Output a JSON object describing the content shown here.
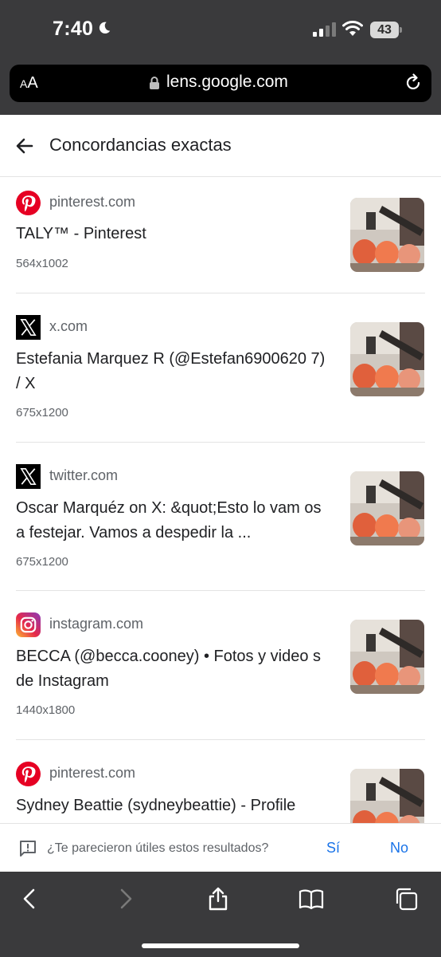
{
  "status_bar": {
    "time": "7:40",
    "battery": "43"
  },
  "browser": {
    "text_size_label_small": "A",
    "text_size_label_large": "A",
    "url": "lens.google.com"
  },
  "header": {
    "title": "Concordancias exactas"
  },
  "results": [
    {
      "site": "pinterest.com",
      "logo": "pinterest-icon",
      "title": "TALY™ - Pinterest",
      "dimensions": "564x1002"
    },
    {
      "site": "x.com",
      "logo": "x-icon",
      "title": "Estefania Marquez R (@Estefan6900620 7) / X",
      "dimensions": "675x1200"
    },
    {
      "site": "twitter.com",
      "logo": "x-icon",
      "title": "Oscar Marquéz on X: &quot;Esto lo vam os a festejar. Vamos a despedir la ...",
      "dimensions": "675x1200"
    },
    {
      "site": "instagram.com",
      "logo": "instagram-icon",
      "title": "BECCA (@becca.cooney) • Fotos y video s de Instagram",
      "dimensions": "1440x1800"
    },
    {
      "site": "pinterest.com",
      "logo": "pinterest-icon",
      "title": "Sydney Beattie (sydneybeattie) - Profile",
      "dimensions": ""
    }
  ],
  "feedback": {
    "question": "¿Te parecieron útiles estos resultados?",
    "yes": "Sí",
    "no": "No"
  },
  "colors": {
    "link_blue": "#1a73e8",
    "chrome_gray": "#3a3a3c",
    "pinterest_red": "#e60023"
  }
}
